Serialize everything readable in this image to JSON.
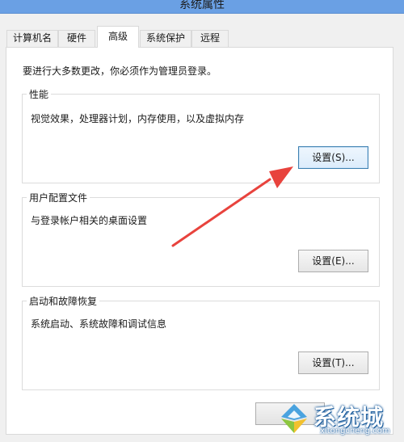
{
  "window": {
    "title": "系统属性"
  },
  "tabs": [
    {
      "label": "计算机名"
    },
    {
      "label": "硬件"
    },
    {
      "label": "高级",
      "active": true
    },
    {
      "label": "系统保护"
    },
    {
      "label": "远程"
    }
  ],
  "admin_note": "要进行大多数更改，你必须作为管理员登录。",
  "performance": {
    "title": "性能",
    "description": "视觉效果，处理器计划，内存使用，以及虚拟内存",
    "button": "设置(S)..."
  },
  "user_profiles": {
    "title": "用户配置文件",
    "description": "与登录帐户相关的桌面设置",
    "button": "设置(E)..."
  },
  "startup_recovery": {
    "title": "启动和故障恢复",
    "description": "系统启动、系统故障和调试信息",
    "button": "设置(T)..."
  },
  "watermark": {
    "brand": "系统城",
    "domain": "xitongcheng.com"
  },
  "colors": {
    "arrow": "#e8433d",
    "titlebar": "#6aa0e4",
    "focus_border": "#3c7fb1"
  }
}
